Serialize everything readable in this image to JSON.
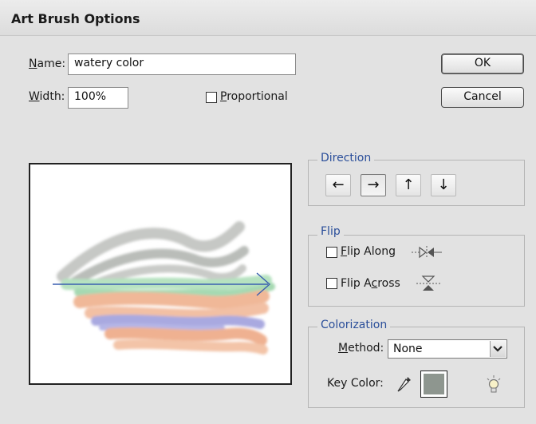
{
  "window": {
    "title": "Art Brush Options"
  },
  "name_field": {
    "label": "Name:",
    "value": "watery color"
  },
  "width_field": {
    "label": "Width:",
    "value": "100%"
  },
  "proportional": {
    "label": "Proportional",
    "checked": false
  },
  "buttons": {
    "ok": "OK",
    "cancel": "Cancel"
  },
  "direction": {
    "title": "Direction",
    "options": [
      {
        "icon": "arrow-left-icon",
        "glyph": "←"
      },
      {
        "icon": "arrow-right-icon",
        "glyph": "→",
        "selected": true
      },
      {
        "icon": "arrow-up-icon",
        "glyph": "↑"
      },
      {
        "icon": "arrow-down-icon",
        "glyph": "↓"
      }
    ]
  },
  "flip": {
    "title": "Flip",
    "along": {
      "label": "Flip Along",
      "checked": false,
      "icon": "flip-along-icon"
    },
    "across": {
      "label": "Flip Across",
      "checked": false,
      "icon": "flip-across-icon"
    }
  },
  "colorization": {
    "title": "Colorization",
    "method_label": "Method:",
    "method_value": "None",
    "key_color_label": "Key Color:",
    "key_color": "#8e968f",
    "eyedropper_icon": "eyedropper-icon",
    "tips_icon": "lightbulb-icon"
  },
  "colors": {
    "accent": "#2a4e9a",
    "dialog_bg": "#e2e2e2",
    "stroke_gray": "#b9bcb8",
    "stroke_green": "#a9dcb4",
    "stroke_orange": "#efb191",
    "stroke_blue": "#a9a9e0",
    "direction_arrow": "#3a5fb0"
  }
}
